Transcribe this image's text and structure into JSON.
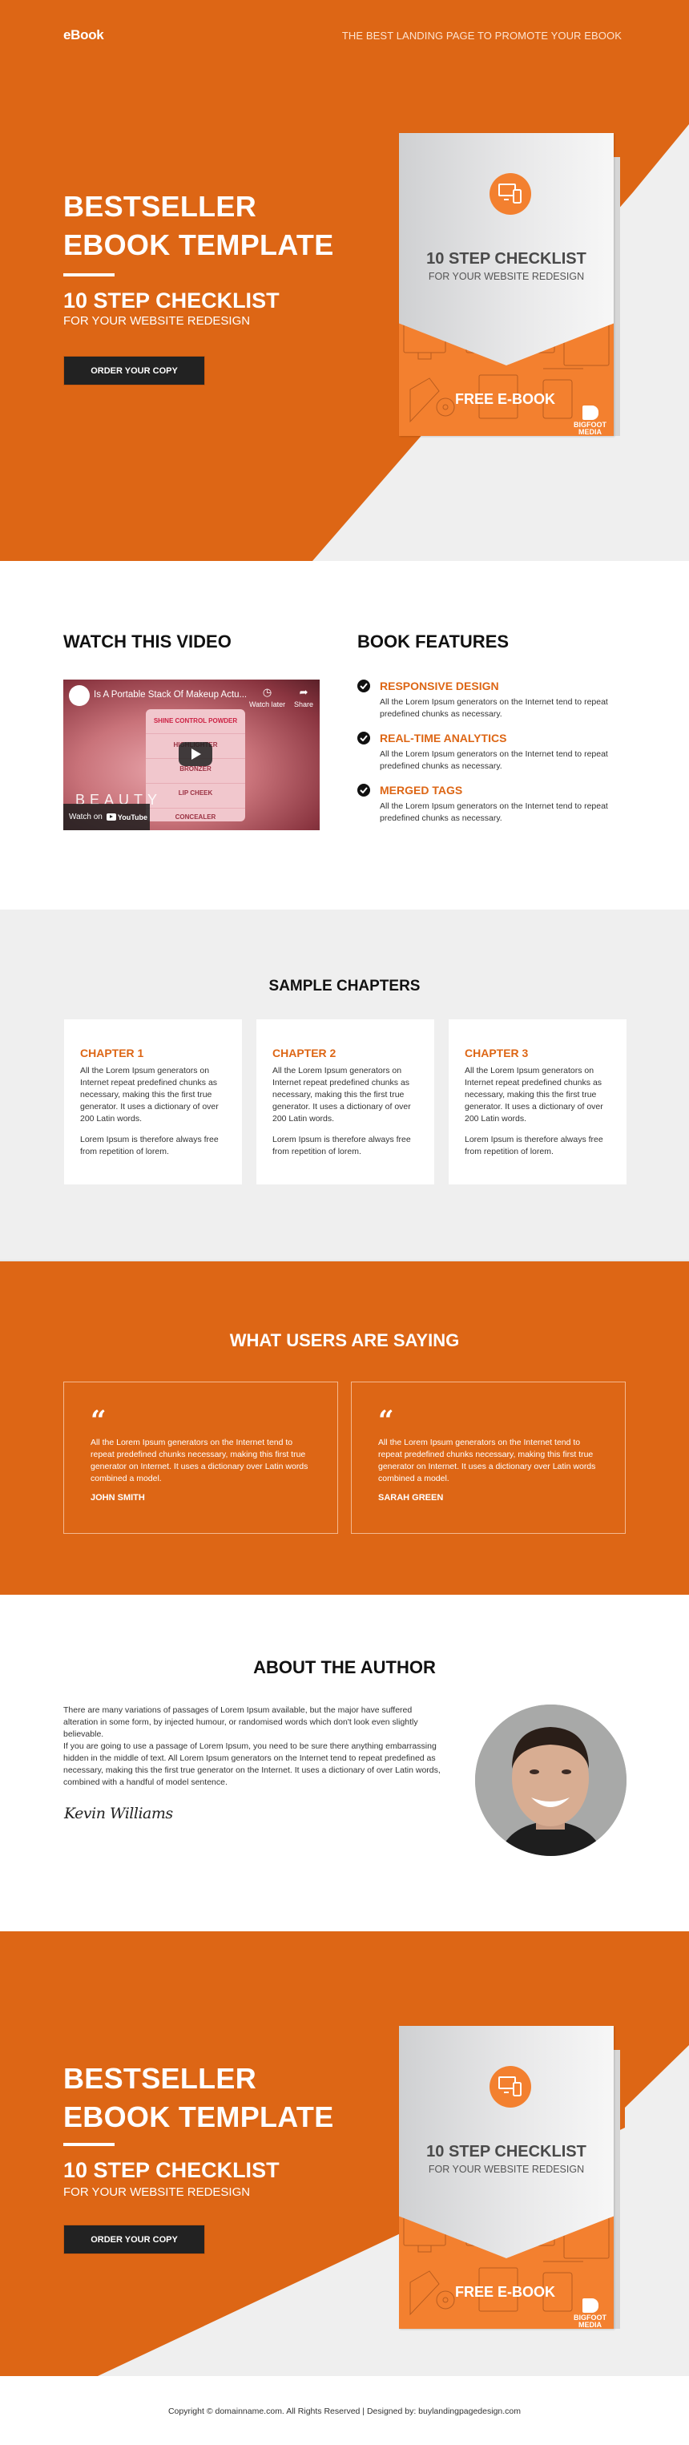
{
  "header": {
    "brand": "eBook",
    "tagline": "THE BEST LANDING PAGE TO PROMOTE YOUR EBOOK"
  },
  "hero": {
    "title_line1": "BESTSELLER",
    "title_line2": "EBOOK TEMPLATE",
    "subtitle": "10 STEP CHECKLIST",
    "subtitle2": "FOR YOUR WEBSITE REDESIGN",
    "cta_label": "ORDER YOUR COPY"
  },
  "book_cover": {
    "icon": "devices-icon",
    "title": "10 STEP CHECKLIST",
    "subtitle": "FOR YOUR WEBSITE REDESIGN",
    "badge": "FREE E-BOOK",
    "publisher_line1": "BIGFOOT",
    "publisher_line2": "MEDIA"
  },
  "video_section": {
    "heading": "WATCH THIS VIDEO",
    "video_title": "Is A Portable Stack Of Makeup Actu...",
    "watch_later": "Watch later",
    "share": "Share",
    "watch_on": "Watch on",
    "youtube": "YouTube",
    "overlay_text": "BEAUTY",
    "stack_labels": [
      "SHINE CONTROL POWDER",
      "HIGHLIGHTER",
      "BRONZER",
      "LIP CHEEK",
      "CONCEALER"
    ]
  },
  "features": {
    "heading": "BOOK FEATURES",
    "items": [
      {
        "title": "RESPONSIVE DESIGN",
        "desc": "All the Lorem Ipsum generators on the Internet tend to repeat predefined chunks as necessary."
      },
      {
        "title": "REAL-TIME ANALYTICS",
        "desc": "All the Lorem Ipsum generators on the Internet tend to repeat predefined chunks as necessary."
      },
      {
        "title": "MERGED TAGS",
        "desc": "All the Lorem Ipsum generators on the Internet tend to repeat predefined chunks as necessary."
      }
    ]
  },
  "chapters": {
    "heading": "SAMPLE CHAPTERS",
    "items": [
      {
        "title": "CHAPTER 1",
        "p1": "All the Lorem Ipsum generators on Internet repeat predefined chunks as necessary, making this the first true generator. It uses a dictionary of over 200 Latin words.",
        "p2": "Lorem Ipsum is therefore always free from repetition of lorem."
      },
      {
        "title": "CHAPTER 2",
        "p1": "All the Lorem Ipsum generators on Internet repeat predefined chunks as necessary, making this the first true generator. It uses a dictionary of over 200 Latin words.",
        "p2": "Lorem Ipsum is therefore always free from repetition of lorem."
      },
      {
        "title": "CHAPTER 3",
        "p1": "All the Lorem Ipsum generators on Internet repeat predefined chunks as necessary, making this the first true generator. It uses a dictionary of over 200 Latin words.",
        "p2": "Lorem Ipsum is therefore always free from repetition of lorem."
      }
    ]
  },
  "testimonials": {
    "heading": "WHAT USERS ARE SAYING",
    "quote_mark": "“",
    "items": [
      {
        "text": "All the Lorem Ipsum generators on the Internet tend to repeat predefined chunks necessary, making this first true generator on Internet. It uses a dictionary over Latin words combined a model.",
        "name": "JOHN SMITH"
      },
      {
        "text": "All the Lorem Ipsum generators on the Internet tend to repeat predefined chunks necessary, making this first true generator on Internet. It uses a dictionary over Latin words combined a model.",
        "name": "SARAH GREEN"
      }
    ]
  },
  "about": {
    "heading": "ABOUT THE AUTHOR",
    "p1": "There are many variations of passages of Lorem Ipsum available, but the major have suffered alteration in some form, by injected humour, or randomised words which don't look even slightly believable.",
    "p2": "If you are going to use a passage of Lorem Ipsum, you need to be sure there anything embarrassing hidden in the middle of text. All Lorem Ipsum generators on the Internet tend to repeat predefined as necessary, making this the first true generator on the Internet. It uses a dictionary of over Latin words, combined with a handful of model sentence.",
    "signature": "Kevin Williams"
  },
  "footer": {
    "copyright": "Copyright © domainname.com. All Rights Reserved | Designed by: buylandingpagedesign.com"
  },
  "colors": {
    "accent": "#dd6615",
    "book_orange": "#f3802f",
    "dark_button": "#222222",
    "light_gray": "#efefef"
  }
}
